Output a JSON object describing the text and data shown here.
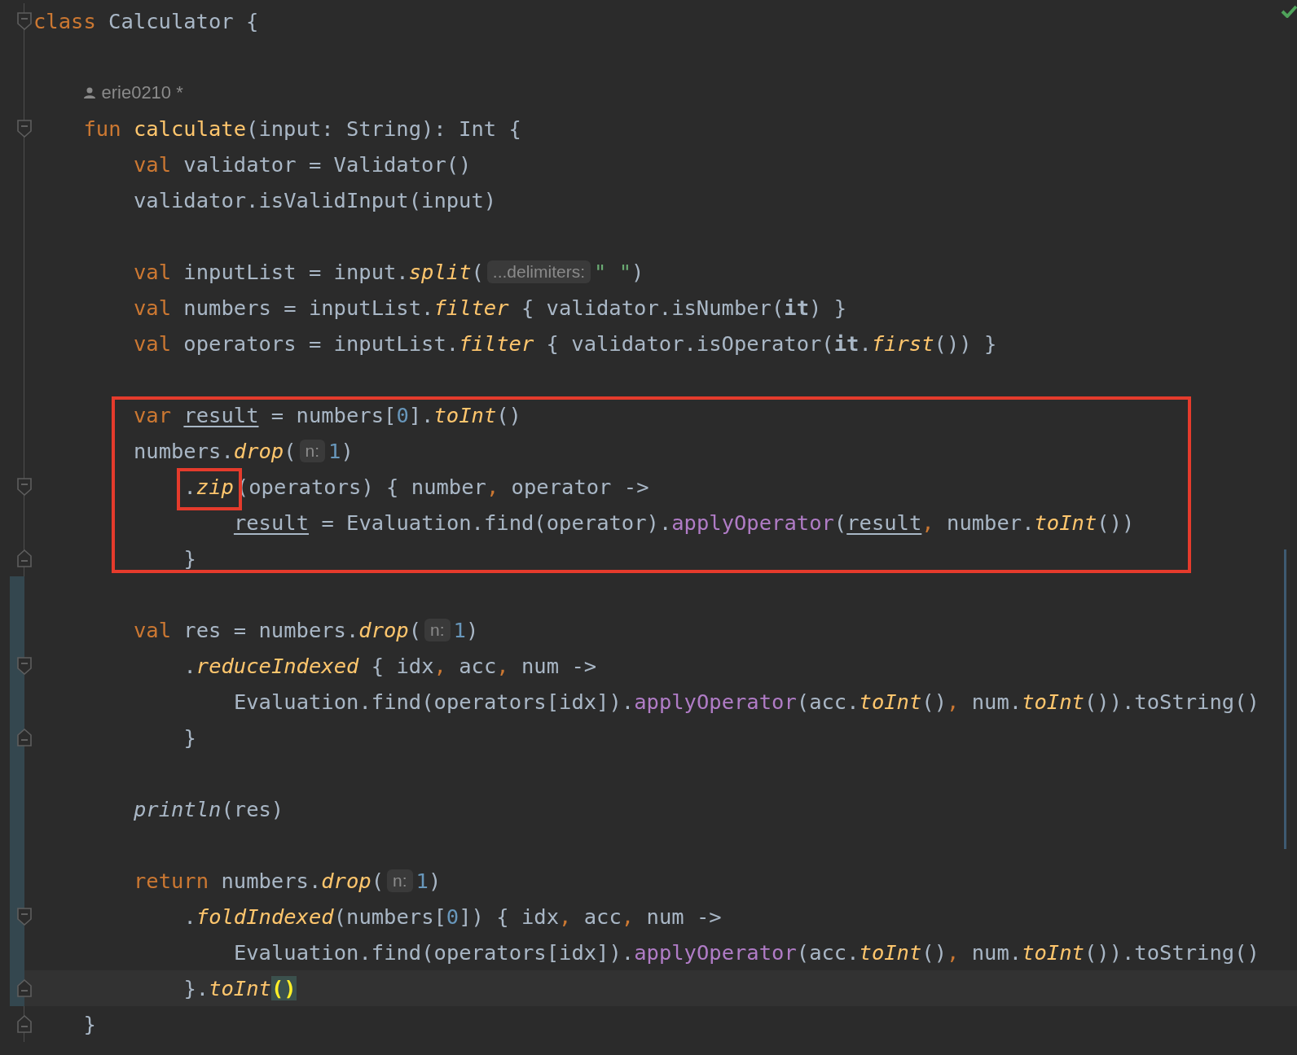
{
  "status": {
    "ok": true
  },
  "annotations": [
    {
      "kind": "frame"
    },
    {
      "kind": "frame"
    }
  ],
  "lines": [
    {
      "fold_start": true,
      "fold_end": false,
      "changed": false,
      "current": false,
      "segments": [
        {
          "kind": "code",
          "tokens": [
            {
              "kind": "kw",
              "text": "class"
            },
            {
              "kind": "plain",
              "text": " Calculator {"
            }
          ]
        }
      ],
      "children": [
        {
          "fold_start": false,
          "fold_end": false,
          "changed": false,
          "current": false
        },
        {
          "kind": "author",
          "fold_start": false,
          "fold_end": false,
          "changed": false,
          "current": false,
          "author": "erie0210 *"
        },
        {
          "fold_start": true,
          "fold_end": false,
          "changed": false,
          "current": false,
          "segments": [
            {
              "kind": "code",
              "tokens": [
                {
                  "kind": "kw",
                  "text": "fun "
                },
                {
                  "kind": "decl",
                  "text": "calculate"
                },
                {
                  "kind": "plain",
                  "text": "(input: String): Int {"
                }
              ]
            }
          ],
          "children": [
            {
              "fold_start": false,
              "fold_end": false,
              "changed": false,
              "current": false,
              "segments": [
                {
                  "kind": "code",
                  "tokens": [
                    {
                      "kind": "kw",
                      "text": "val"
                    },
                    {
                      "kind": "plain",
                      "text": " validator = Validator()"
                    }
                  ]
                }
              ]
            },
            {
              "fold_start": false,
              "fold_end": false,
              "changed": false,
              "current": false,
              "segments": [
                {
                  "kind": "code",
                  "tokens": [
                    {
                      "kind": "plain",
                      "text": "validator.isValidInput(input)"
                    }
                  ]
                }
              ]
            },
            {
              "fold_start": false,
              "fold_end": false,
              "changed": false,
              "current": false
            },
            {
              "fold_start": false,
              "fold_end": false,
              "changed": false,
              "current": false,
              "segments": [
                {
                  "kind": "code",
                  "tokens": [
                    {
                      "kind": "kw",
                      "text": "val"
                    },
                    {
                      "kind": "plain",
                      "text": " inputList = input."
                    },
                    {
                      "kind": "ext",
                      "text": "split"
                    },
                    {
                      "kind": "plain",
                      "text": "("
                    }
                  ]
                },
                {
                  "kind": "hint",
                  "text": "...delimiters:"
                },
                {
                  "kind": "code",
                  "tokens": [
                    {
                      "kind": "str",
                      "text": "\" \""
                    },
                    {
                      "kind": "plain",
                      "text": ")"
                    }
                  ]
                }
              ]
            },
            {
              "fold_start": false,
              "fold_end": false,
              "changed": false,
              "current": false,
              "segments": [
                {
                  "kind": "code",
                  "tokens": [
                    {
                      "kind": "kw",
                      "text": "val"
                    },
                    {
                      "kind": "plain",
                      "text": " numbers = inputList."
                    },
                    {
                      "kind": "ext",
                      "text": "filter"
                    },
                    {
                      "kind": "plain",
                      "text": " { validator.isNumber("
                    },
                    {
                      "kind": "bold",
                      "text": "it"
                    },
                    {
                      "kind": "plain",
                      "text": ") }"
                    }
                  ]
                }
              ]
            },
            {
              "fold_start": false,
              "fold_end": false,
              "changed": false,
              "current": false,
              "segments": [
                {
                  "kind": "code",
                  "tokens": [
                    {
                      "kind": "kw",
                      "text": "val"
                    },
                    {
                      "kind": "plain",
                      "text": " operators = inputList."
                    },
                    {
                      "kind": "ext",
                      "text": "filter"
                    },
                    {
                      "kind": "plain",
                      "text": " { validator.isOperator("
                    },
                    {
                      "kind": "bold",
                      "text": "it"
                    },
                    {
                      "kind": "plain",
                      "text": "."
                    },
                    {
                      "kind": "ext",
                      "text": "first"
                    },
                    {
                      "kind": "plain",
                      "text": "()) }"
                    }
                  ]
                }
              ]
            },
            {
              "fold_start": false,
              "fold_end": false,
              "changed": false,
              "current": false
            },
            {
              "fold_start": false,
              "fold_end": false,
              "changed": false,
              "current": false,
              "segments": [
                {
                  "kind": "code",
                  "tokens": [
                    {
                      "kind": "kw",
                      "text": "var "
                    },
                    {
                      "kind": "var",
                      "text": "result"
                    },
                    {
                      "kind": "plain",
                      "text": " = numbers["
                    },
                    {
                      "kind": "num",
                      "text": "0"
                    },
                    {
                      "kind": "plain",
                      "text": "]."
                    },
                    {
                      "kind": "ext",
                      "text": "toInt"
                    },
                    {
                      "kind": "plain",
                      "text": "()"
                    }
                  ]
                }
              ]
            },
            {
              "fold_start": false,
              "fold_end": false,
              "changed": false,
              "current": false,
              "segments": [
                {
                  "kind": "code",
                  "tokens": [
                    {
                      "kind": "plain",
                      "text": "numbers."
                    },
                    {
                      "kind": "ext",
                      "text": "drop"
                    },
                    {
                      "kind": "plain",
                      "text": "("
                    }
                  ]
                },
                {
                  "kind": "hint",
                  "text": "n:"
                },
                {
                  "kind": "code",
                  "tokens": [
                    {
                      "kind": "num",
                      "text": "1"
                    },
                    {
                      "kind": "plain",
                      "text": ")"
                    }
                  ]
                }
              ],
              "children": [
                {
                  "fold_start": true,
                  "fold_end": false,
                  "changed": false,
                  "current": false,
                  "segments": [
                    {
                      "kind": "code",
                      "tokens": [
                        {
                          "kind": "plain",
                          "text": "."
                        },
                        {
                          "kind": "ext",
                          "text": "zip"
                        }
                      ]
                    },
                    {
                      "kind": "code",
                      "tokens": [
                        {
                          "kind": "plain",
                          "text": "(operators) { number"
                        },
                        {
                          "kind": "kw",
                          "text": ","
                        },
                        {
                          "kind": "plain",
                          "text": " operator ->"
                        }
                      ]
                    }
                  ],
                  "children": [
                    {
                      "fold_start": false,
                      "fold_end": false,
                      "changed": false,
                      "current": false,
                      "segments": [
                        {
                          "kind": "code",
                          "tokens": [
                            {
                              "kind": "var",
                              "text": "result"
                            },
                            {
                              "kind": "plain",
                              "text": " = Evaluation.find(operator)."
                            },
                            {
                              "kind": "op",
                              "text": "applyOperator"
                            },
                            {
                              "kind": "plain",
                              "text": "("
                            },
                            {
                              "kind": "var",
                              "text": "result"
                            },
                            {
                              "kind": "kw",
                              "text": ","
                            },
                            {
                              "kind": "plain",
                              "text": " number."
                            },
                            {
                              "kind": "ext",
                              "text": "toInt"
                            },
                            {
                              "kind": "plain",
                              "text": "())"
                            }
                          ]
                        }
                      ]
                    }
                  ]
                },
                {
                  "fold_start": false,
                  "fold_end": true,
                  "changed": false,
                  "current": false,
                  "segments": [
                    {
                      "kind": "code",
                      "tokens": [
                        {
                          "kind": "plain",
                          "text": "}"
                        }
                      ]
                    }
                  ]
                }
              ]
            },
            {
              "fold_start": false,
              "fold_end": false,
              "changed": true,
              "current": false
            },
            {
              "fold_start": false,
              "fold_end": false,
              "changed": true,
              "current": false,
              "segments": [
                {
                  "kind": "code",
                  "tokens": [
                    {
                      "kind": "kw",
                      "text": "val"
                    },
                    {
                      "kind": "plain",
                      "text": " res = numbers."
                    },
                    {
                      "kind": "ext",
                      "text": "drop"
                    },
                    {
                      "kind": "plain",
                      "text": "("
                    }
                  ]
                },
                {
                  "kind": "hint",
                  "text": "n:"
                },
                {
                  "kind": "code",
                  "tokens": [
                    {
                      "kind": "num",
                      "text": "1"
                    },
                    {
                      "kind": "plain",
                      "text": ")"
                    }
                  ]
                }
              ],
              "children": [
                {
                  "fold_start": true,
                  "fold_end": false,
                  "changed": true,
                  "current": false,
                  "segments": [
                    {
                      "kind": "code",
                      "tokens": [
                        {
                          "kind": "plain",
                          "text": "."
                        },
                        {
                          "kind": "ext",
                          "text": "reduceIndexed"
                        },
                        {
                          "kind": "plain",
                          "text": " { idx"
                        },
                        {
                          "kind": "kw",
                          "text": ","
                        },
                        {
                          "kind": "plain",
                          "text": " acc"
                        },
                        {
                          "kind": "kw",
                          "text": ","
                        },
                        {
                          "kind": "plain",
                          "text": " num ->"
                        }
                      ]
                    }
                  ],
                  "children": [
                    {
                      "fold_start": false,
                      "fold_end": false,
                      "changed": true,
                      "current": false,
                      "segments": [
                        {
                          "kind": "code",
                          "tokens": [
                            {
                              "kind": "plain",
                              "text": "Evaluation.find(operators[idx])."
                            },
                            {
                              "kind": "op",
                              "text": "applyOperator"
                            },
                            {
                              "kind": "plain",
                              "text": "(acc."
                            },
                            {
                              "kind": "ext",
                              "text": "toInt"
                            },
                            {
                              "kind": "plain",
                              "text": "()"
                            },
                            {
                              "kind": "kw",
                              "text": ","
                            },
                            {
                              "kind": "plain",
                              "text": " num."
                            },
                            {
                              "kind": "ext",
                              "text": "toInt"
                            },
                            {
                              "kind": "plain",
                              "text": "()).toString()"
                            }
                          ]
                        }
                      ]
                    }
                  ]
                },
                {
                  "fold_start": false,
                  "fold_end": true,
                  "changed": true,
                  "current": false,
                  "segments": [
                    {
                      "kind": "code",
                      "tokens": [
                        {
                          "kind": "plain",
                          "text": "}"
                        }
                      ]
                    }
                  ]
                }
              ]
            },
            {
              "fold_start": false,
              "fold_end": false,
              "changed": true,
              "current": false
            },
            {
              "fold_start": false,
              "fold_end": false,
              "changed": true,
              "current": false,
              "segments": [
                {
                  "kind": "code",
                  "tokens": [
                    {
                      "kind": "italic",
                      "text": "println"
                    },
                    {
                      "kind": "plain",
                      "text": "(res)"
                    }
                  ]
                }
              ]
            },
            {
              "fold_start": false,
              "fold_end": false,
              "changed": true,
              "current": false
            },
            {
              "fold_start": false,
              "fold_end": false,
              "changed": true,
              "current": false,
              "segments": [
                {
                  "kind": "code",
                  "tokens": [
                    {
                      "kind": "kw",
                      "text": "return"
                    },
                    {
                      "kind": "plain",
                      "text": " numbers."
                    },
                    {
                      "kind": "ext",
                      "text": "drop"
                    },
                    {
                      "kind": "plain",
                      "text": "("
                    }
                  ]
                },
                {
                  "kind": "hint",
                  "text": "n:"
                },
                {
                  "kind": "code",
                  "tokens": [
                    {
                      "kind": "num",
                      "text": "1"
                    },
                    {
                      "kind": "plain",
                      "text": ")"
                    }
                  ]
                }
              ],
              "children": [
                {
                  "fold_start": true,
                  "fold_end": false,
                  "changed": true,
                  "current": false,
                  "segments": [
                    {
                      "kind": "code",
                      "tokens": [
                        {
                          "kind": "plain",
                          "text": "."
                        },
                        {
                          "kind": "ext",
                          "text": "foldIndexed"
                        },
                        {
                          "kind": "plain",
                          "text": "(numbers["
                        },
                        {
                          "kind": "num",
                          "text": "0"
                        },
                        {
                          "kind": "plain",
                          "text": "]) { idx"
                        },
                        {
                          "kind": "kw",
                          "text": ","
                        },
                        {
                          "kind": "plain",
                          "text": " acc"
                        },
                        {
                          "kind": "kw",
                          "text": ","
                        },
                        {
                          "kind": "plain",
                          "text": " num ->"
                        }
                      ]
                    }
                  ],
                  "children": [
                    {
                      "fold_start": false,
                      "fold_end": false,
                      "changed": true,
                      "current": false,
                      "segments": [
                        {
                          "kind": "code",
                          "tokens": [
                            {
                              "kind": "plain",
                              "text": "Evaluation.find(operators[idx])."
                            },
                            {
                              "kind": "op",
                              "text": "applyOperator"
                            },
                            {
                              "kind": "plain",
                              "text": "(acc."
                            },
                            {
                              "kind": "ext",
                              "text": "toInt"
                            },
                            {
                              "kind": "plain",
                              "text": "()"
                            },
                            {
                              "kind": "kw",
                              "text": ","
                            },
                            {
                              "kind": "plain",
                              "text": " num."
                            },
                            {
                              "kind": "ext",
                              "text": "toInt"
                            },
                            {
                              "kind": "plain",
                              "text": "()).toString()"
                            }
                          ]
                        }
                      ]
                    }
                  ]
                },
                {
                  "fold_start": false,
                  "fold_end": true,
                  "changed": true,
                  "current": true,
                  "segments": [
                    {
                      "kind": "code",
                      "tokens": [
                        {
                          "kind": "plain",
                          "text": "}."
                        },
                        {
                          "kind": "ext",
                          "text": "toInt"
                        },
                        {
                          "kind": "match",
                          "text": "()"
                        }
                      ]
                    }
                  ]
                }
              ]
            }
          ]
        },
        {
          "fold_start": false,
          "fold_end": true,
          "changed": false,
          "current": false,
          "segments": [
            {
              "kind": "code",
              "tokens": [
                {
                  "kind": "plain",
                  "text": "}"
                }
              ]
            }
          ]
        }
      ]
    }
  ]
}
